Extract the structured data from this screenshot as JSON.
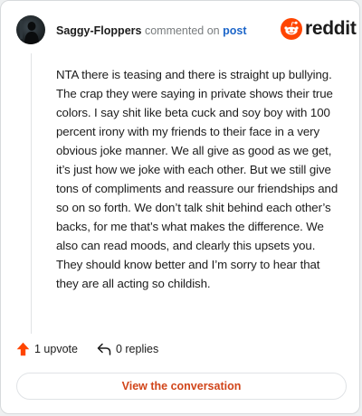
{
  "header": {
    "username": "Saggy-Floppers",
    "commented_text": "commented on",
    "post_link": "post",
    "brand": "reddit"
  },
  "comment": {
    "body": "NTA there is teasing and there is straight up bullying. The crap they were saying in private shows their true colors. I say shit like beta cuck and soy boy with 100 percent irony with my friends to their face in a very obvious joke manner. We all give as good as we get, it’s just how we joke with each other. But we still give tons of compliments and reassure our friendships and so on so forth. We don’t talk shit behind each other’s backs, for me that’s what makes the difference. We also can read moods, and clearly this upsets you. They should know better and I’m sorry to hear that they are all acting so childish."
  },
  "actions": {
    "upvotes": "1 upvote",
    "replies": "0 replies",
    "upvote_icon": "upvote-arrow-icon",
    "reply_icon": "reply-arrow-icon"
  },
  "footer": {
    "view_conversation": "View the conversation"
  },
  "colors": {
    "brand_orange": "#ff4500",
    "link_blue": "#1d66c9",
    "cta_text": "#d1451a",
    "muted": "#787c7e"
  }
}
